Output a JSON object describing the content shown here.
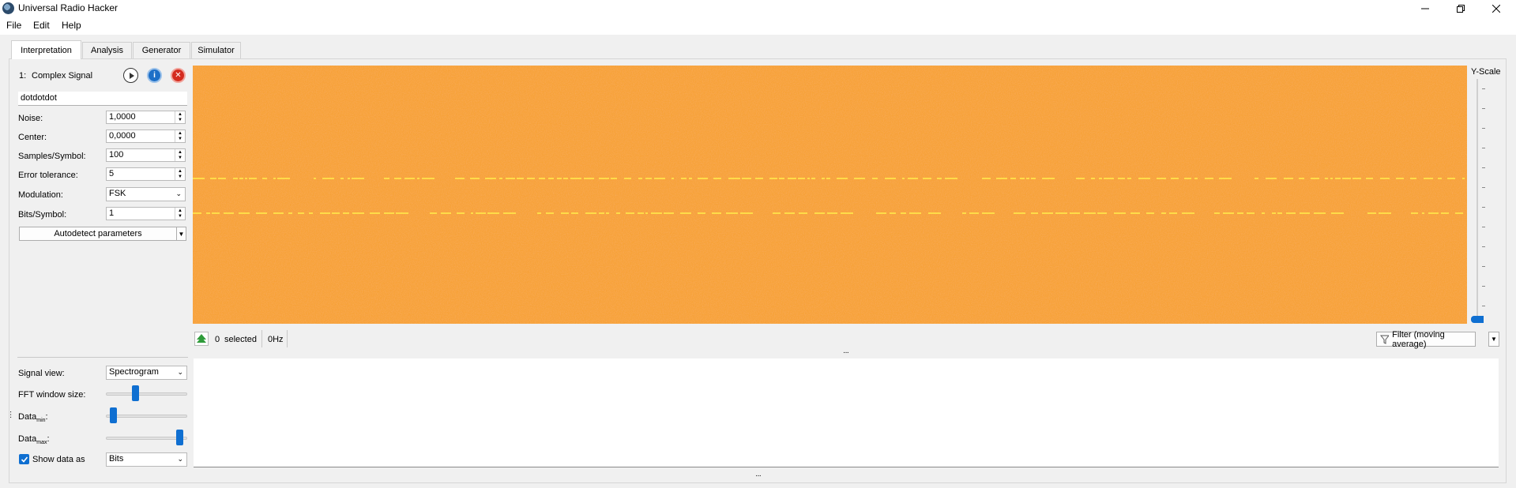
{
  "window": {
    "title": "Universal Radio Hacker",
    "controls": [
      "minimize",
      "restore",
      "close"
    ]
  },
  "menu": [
    "File",
    "Edit",
    "Help"
  ],
  "tabs": [
    "Interpretation",
    "Analysis",
    "Generator",
    "Simulator"
  ],
  "active_tab": "Interpretation",
  "signal": {
    "index": "1:",
    "name": "Complex Signal",
    "title_field": "dotdotdot",
    "noise_label": "Noise:",
    "noise_value": "1,0000",
    "center_label": "Center:",
    "center_value": "0,0000",
    "samples_label": "Samples/Symbol:",
    "samples_value": "100",
    "error_label": "Error tolerance:",
    "error_value": "5",
    "modulation_label": "Modulation:",
    "modulation_value": "FSK",
    "bits_label": "Bits/Symbol:",
    "bits_value": "1",
    "autodetect_label": "Autodetect parameters"
  },
  "status": {
    "selected_count": "0",
    "selected_label": "selected",
    "frequency": "0Hz",
    "filter_label": "Filter (moving average)"
  },
  "yscale_label": "Y-Scale",
  "view": {
    "signal_view_label": "Signal view:",
    "signal_view_value": "Spectrogram",
    "fft_label": "FFT window size:",
    "fft_level": 0.35,
    "datamin_label": "Data",
    "datamin_sub": "min",
    "datamin_level": 0.05,
    "datamax_label": "Data",
    "datamax_sub": "max",
    "datamax_level": 0.95,
    "show_data_label": "Show data as",
    "show_data_checked": true,
    "show_data_value": "Bits"
  },
  "colors": {
    "spectrogram_base": "#f7a238",
    "spectrogram_line": "#ffe24a",
    "accent": "#0f6fd1"
  }
}
